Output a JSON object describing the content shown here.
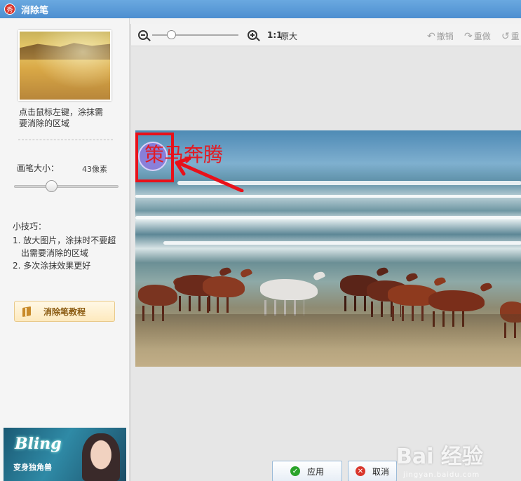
{
  "window": {
    "title": "消除笔",
    "logo_text": "秀"
  },
  "left_panel": {
    "hint": "点击鼠标左键，涂抹需要消除的区域",
    "brush_size_label": "画笔大小：",
    "brush_size_value": "43像素",
    "brush_size_fraction": 0.36,
    "tips_title": "小技巧：",
    "tips": [
      "1. 放大图片，涂抹时不要超出需要消除的区域",
      "2. 多次涂抹效果更好"
    ],
    "tutorial_button": "消除笔教程",
    "ad": {
      "title": "Bling",
      "subtitle": "变身独角兽"
    }
  },
  "toolbar": {
    "ratio_label": "1:1",
    "ratio_text": "原大",
    "zoom_fraction": 0.22,
    "undo": "撤销",
    "redo": "重做",
    "reset": "重"
  },
  "canvas": {
    "annotation_text": "策马奔腾"
  },
  "footer": {
    "apply": "应用",
    "cancel": "取消"
  },
  "watermark": {
    "main": "Bai 经验",
    "sub": "jingyan.baidu.com"
  },
  "colors": {
    "titlebar": "#4d8fd0",
    "annotation_red": "#e8111a",
    "apply_green": "#2aa32a",
    "cancel_red": "#d9362c"
  }
}
